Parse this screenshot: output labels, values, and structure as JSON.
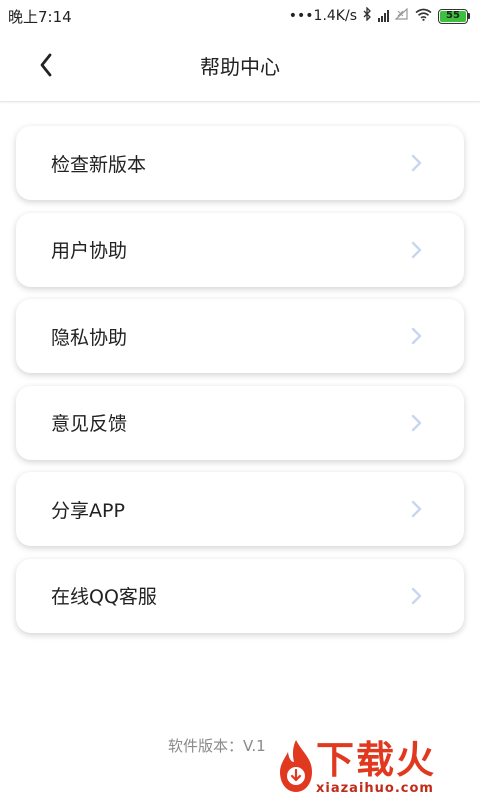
{
  "status_bar": {
    "time": "晚上7:14",
    "network_speed": "•••1.4K/s",
    "battery_level": "55",
    "icons": [
      "bluetooth-icon",
      "hd-signal-icon",
      "no-sim-icon",
      "wifi-icon",
      "battery-icon"
    ]
  },
  "nav": {
    "title": "帮助中心",
    "back_icon": "chevron-left-icon"
  },
  "menu": {
    "items": [
      {
        "label": "检查新版本"
      },
      {
        "label": "用户协助"
      },
      {
        "label": "隐私协助"
      },
      {
        "label": "意见反馈"
      },
      {
        "label": "分享APP"
      },
      {
        "label": "在线QQ客服"
      }
    ],
    "chevron_icon": "chevron-right-icon",
    "chevron_color": "#c8d6ee"
  },
  "footer": {
    "version_text": "软件版本：V.1"
  },
  "watermark": {
    "brand": "下载火",
    "url": "xiazaihuo.com",
    "color": "#e0391f"
  }
}
